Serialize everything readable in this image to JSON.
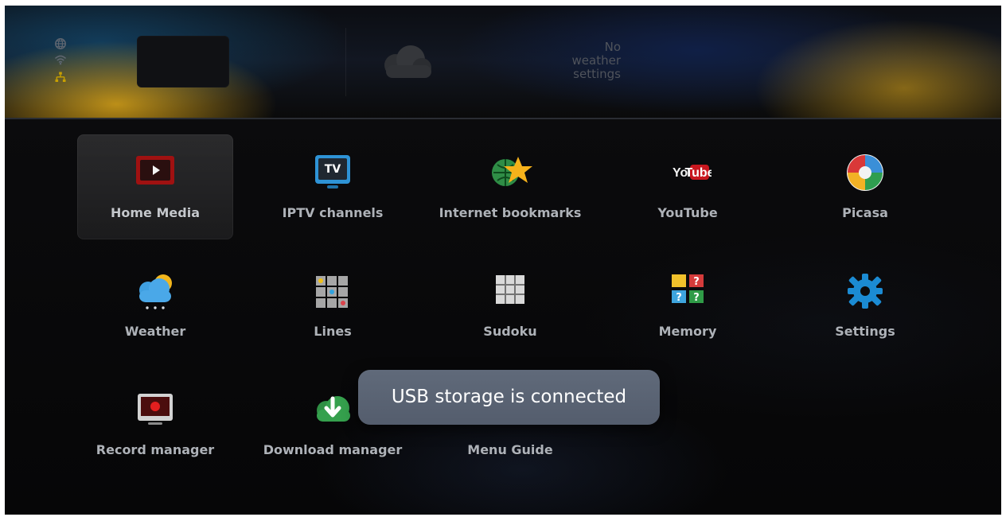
{
  "weather": {
    "message": "No\nweather\nsettings"
  },
  "menu": {
    "items": [
      {
        "label": "Home Media",
        "icon": "home-media-icon",
        "selected": true
      },
      {
        "label": "IPTV channels",
        "icon": "iptv-channels-icon",
        "icon_text": "TV",
        "selected": false
      },
      {
        "label": "Internet bookmarks",
        "icon": "internet-bookmarks-icon",
        "selected": false
      },
      {
        "label": "YouTube",
        "icon": "youtube-icon",
        "icon_text_left": "You",
        "icon_text_right": "Tube",
        "selected": false
      },
      {
        "label": "Picasa",
        "icon": "picasa-icon",
        "selected": false
      },
      {
        "label": "Weather",
        "icon": "weather-icon",
        "selected": false
      },
      {
        "label": "Lines",
        "icon": "lines-icon",
        "selected": false
      },
      {
        "label": "Sudoku",
        "icon": "sudoku-icon",
        "selected": false
      },
      {
        "label": "Memory",
        "icon": "memory-icon",
        "icon_text": "?",
        "selected": false
      },
      {
        "label": "Settings",
        "icon": "settings-icon",
        "selected": false
      },
      {
        "label": "Record manager",
        "icon": "record-manager-icon",
        "selected": false
      },
      {
        "label": "Download manager",
        "icon": "download-manager-icon",
        "selected": false
      },
      {
        "label": "Menu Guide",
        "icon": "menu-guide-icon",
        "selected": false
      }
    ]
  },
  "notification": {
    "text": "USB storage is connected"
  },
  "colors": {
    "background": "#090909",
    "selected_tile": "#2a2b2f",
    "toast": "#5b6474",
    "label_text": "#aeb2b8",
    "weather_text": "#4f535b",
    "status_icon": "#5f6670",
    "network_icon": "#c8a000"
  }
}
